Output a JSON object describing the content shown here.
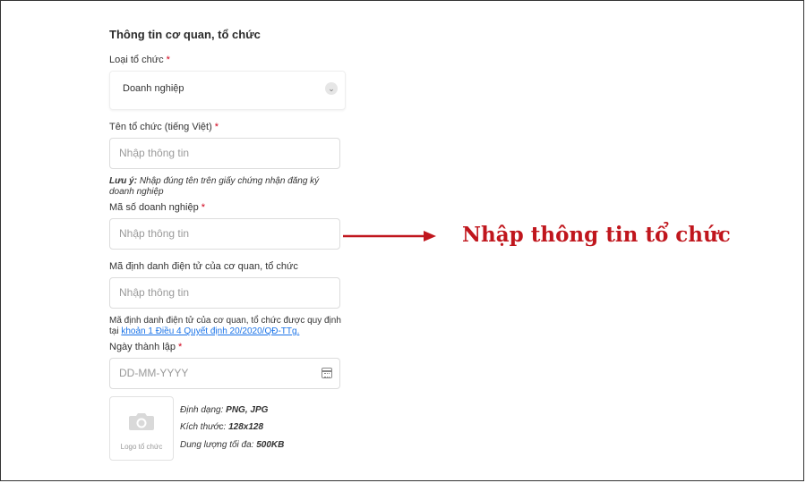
{
  "section": {
    "title": "Thông tin cơ quan, tổ chức"
  },
  "org_type": {
    "label": "Loại tổ chức",
    "required_mark": "*",
    "value": "Doanh nghiệp"
  },
  "org_name": {
    "label": "Tên tổ chức (tiếng Việt)",
    "required_mark": "*",
    "placeholder": "Nhập thông tin",
    "note_prefix": "Lưu ý:",
    "note_text": "Nhập đúng tên trên giấy chứng nhận đăng ký doanh nghiệp"
  },
  "tax_code": {
    "label": "Mã số doanh nghiệp",
    "required_mark": "*",
    "placeholder": "Nhập thông tin"
  },
  "electronic_id": {
    "label": "Mã định danh điện tử của cơ quan, tổ chức",
    "placeholder": "Nhập thông tin",
    "note_text": "Mã định danh điện tử của cơ quan, tổ chức được quy định tại",
    "note_link": "khoản 1 Điều 4 Quyết định 20/2020/QĐ-TTg."
  },
  "founded_date": {
    "label": "Ngày thành lập",
    "required_mark": "*",
    "placeholder": "DD-MM-YYYY"
  },
  "logo": {
    "caption": "Logo tổ chức",
    "format_label": "Định dạng:",
    "format_value": "PNG, JPG",
    "size_label": "Kích thước:",
    "size_value": "128x128",
    "max_label": "Dung lượng tối đa:",
    "max_value": "500KB"
  },
  "callout": {
    "text": "Nhập thông tin tổ chức",
    "color": "#c0161d"
  }
}
